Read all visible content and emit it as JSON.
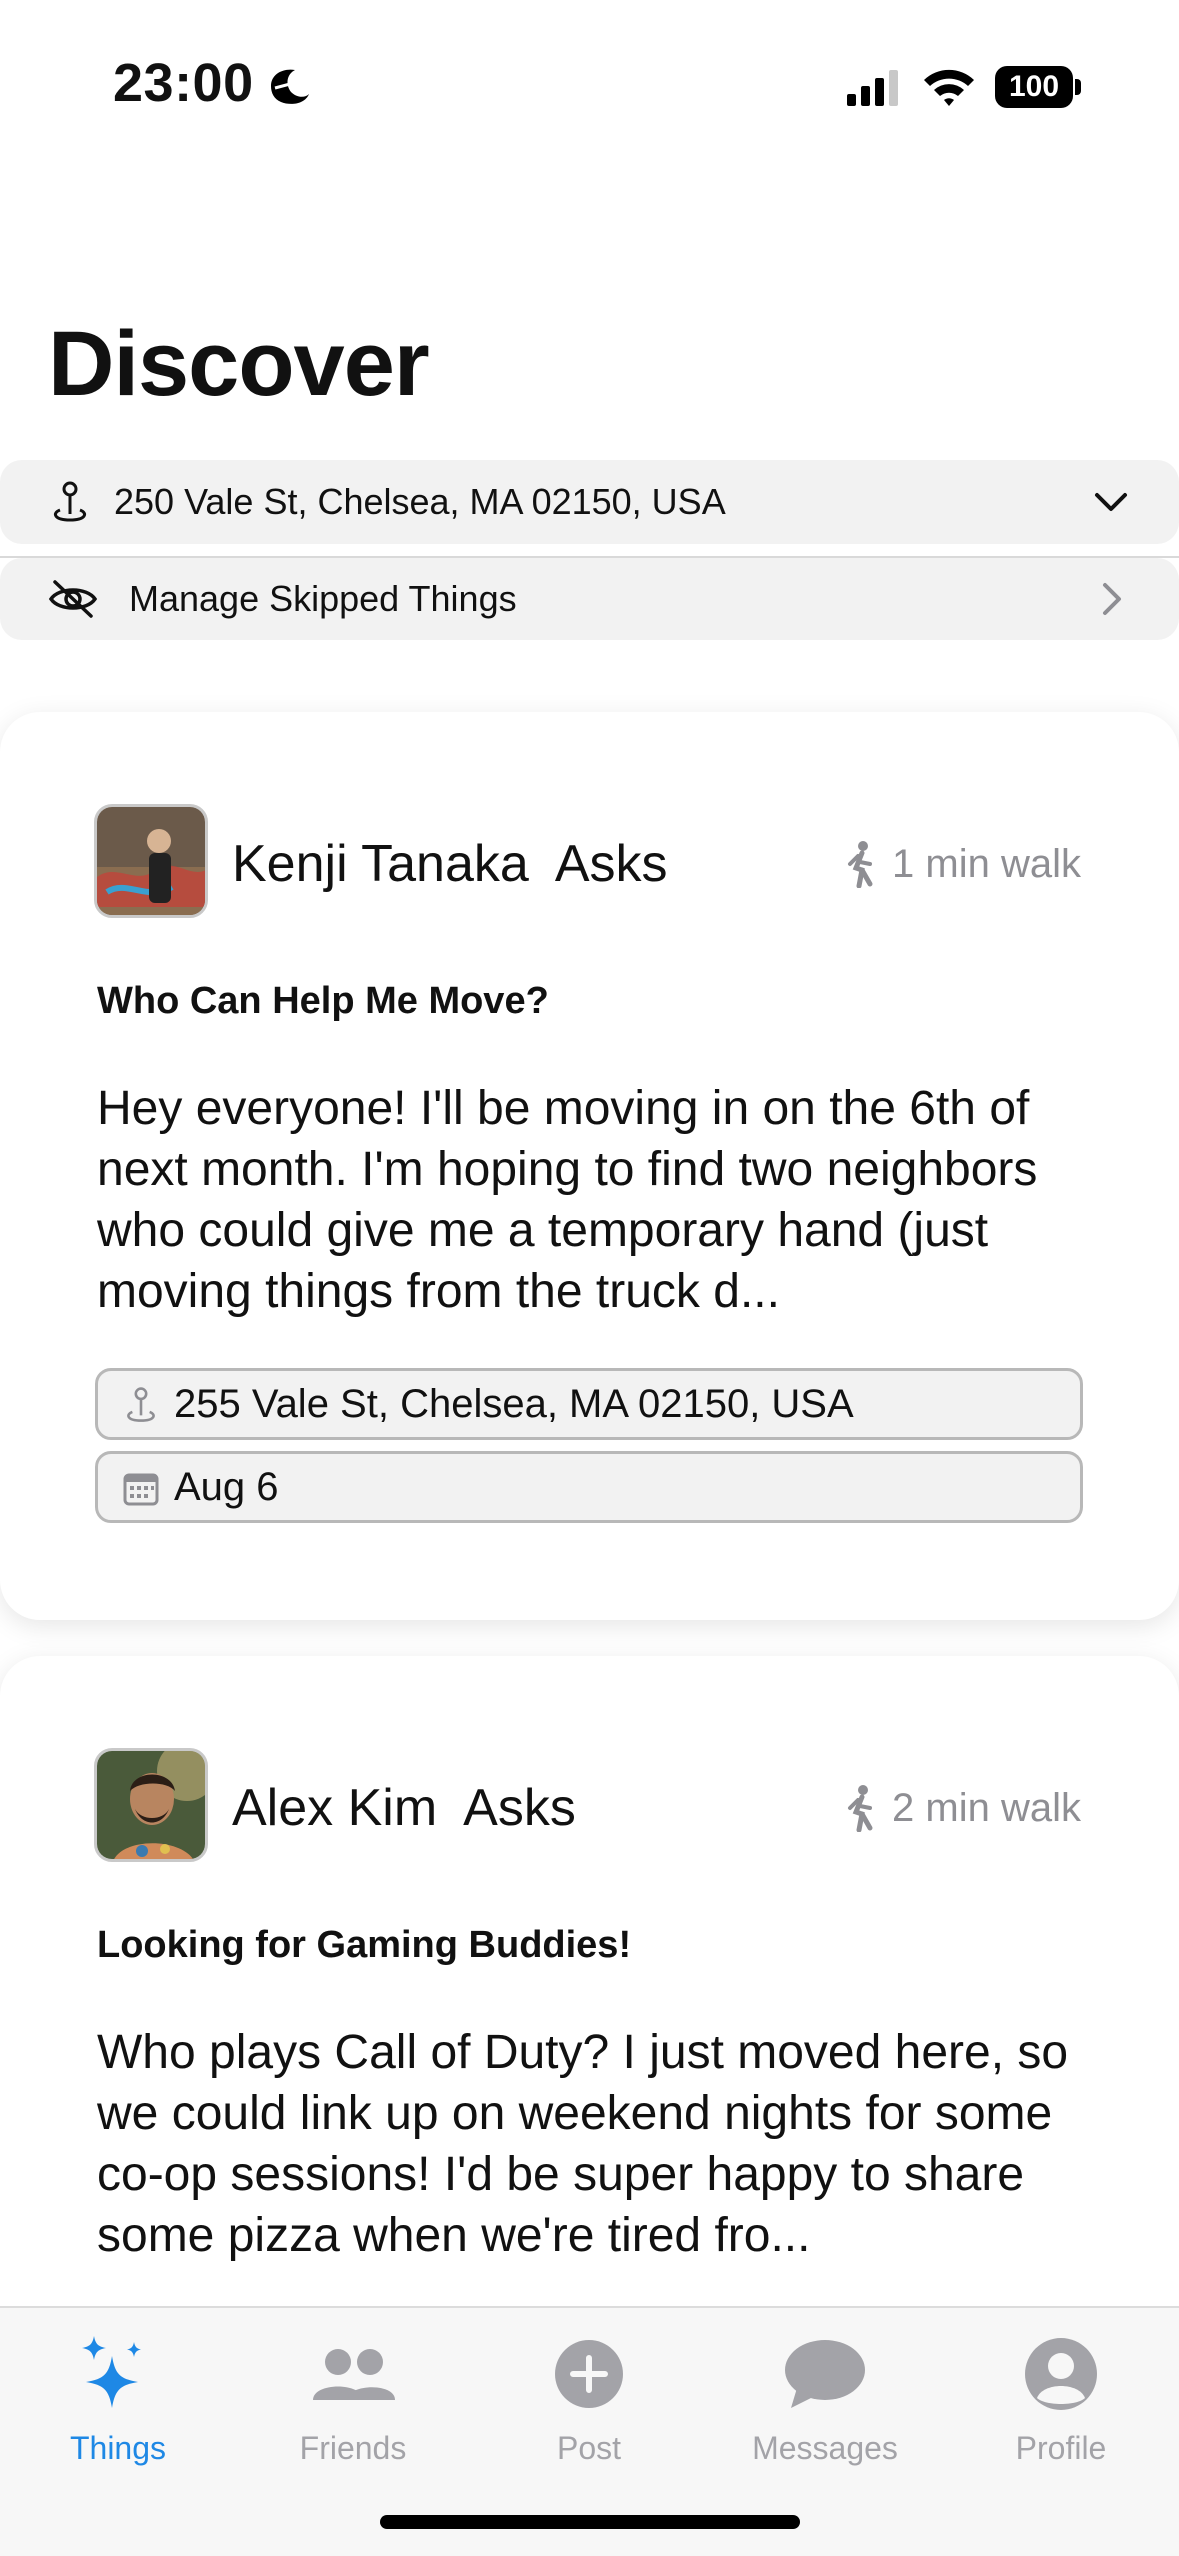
{
  "status": {
    "time": "23:00",
    "battery": "100"
  },
  "page_title": "Discover",
  "location": {
    "address": "250 Vale St, Chelsea, MA 02150, USA"
  },
  "skipped": {
    "label": "Manage Skipped Things"
  },
  "posts": [
    {
      "name": "Kenji Tanaka  Asks",
      "walk": "1 min walk",
      "title": "Who Can Help Me Move?",
      "body": "Hey everyone! I'll be moving in on the 6th of next month. I'm hoping to find two neighbors who could give me a temporary hand (just moving things from the truck d...",
      "address": "255 Vale St, Chelsea, MA 02150, USA",
      "date": "Aug 6"
    },
    {
      "name": "Alex Kim  Asks",
      "walk": "2 min walk",
      "title": "Looking for Gaming Buddies!",
      "body": "Who plays Call of Duty? I just moved here, so we could link up on weekend nights for some co-op sessions! I'd be super happy to share some pizza when we're tired fro..."
    }
  ],
  "tabs": [
    {
      "label": "Things",
      "icon": "sparkles-icon",
      "active": true
    },
    {
      "label": "Friends",
      "icon": "people-icon"
    },
    {
      "label": "Post",
      "icon": "plus-circle-icon"
    },
    {
      "label": "Messages",
      "icon": "chat-bubble-icon"
    },
    {
      "label": "Profile",
      "icon": "person-circle-icon"
    }
  ],
  "colors": {
    "accent": "#1e88e5",
    "inactive": "#a3a3a8",
    "row_bg": "#f2f2f2"
  }
}
